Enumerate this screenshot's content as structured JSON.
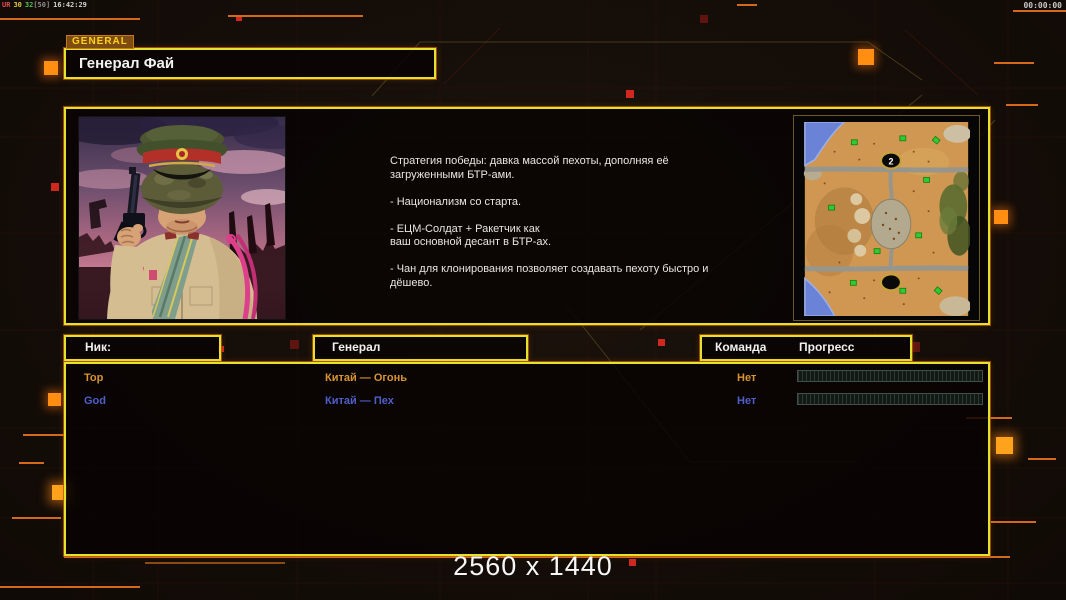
{
  "colors": {
    "accent_yellow": "#e6e22b",
    "accent_orange": "#d4691a",
    "row_gold": "#d79433",
    "row_blue": "#4f5fc8"
  },
  "overlay": {
    "stats": [
      "UR",
      "30",
      "32",
      "[50]",
      "16:42:29"
    ],
    "timer": "00:00:00"
  },
  "general_tab": "GENERAL",
  "title": "Генерал Фай",
  "profile": {
    "description": "Стратегия победы: давка массой пехоты, дополняя её\n загруженными БТР-ами.\n\n- Национализм со старта.\n\n- ЕЦМ-Солдат + Ракетчик как\nваш основной десант в БТР-ах.\n\n- Чан для клонирования позволяет создавать пехоту быстро и\nдёшево.",
    "minimap": {
      "start_marker": "2"
    }
  },
  "table": {
    "headers": {
      "nick": "Ник:",
      "general": "Генерал",
      "team": "Команда",
      "progress": "Прогресс"
    },
    "rows": [
      {
        "nick": "Top",
        "general": "Китай — Огонь",
        "team": "Нет"
      },
      {
        "nick": "God",
        "general": "Китай — Пех",
        "team": "Нет"
      }
    ]
  },
  "footer": {
    "resolution": "2560 x 1440"
  }
}
